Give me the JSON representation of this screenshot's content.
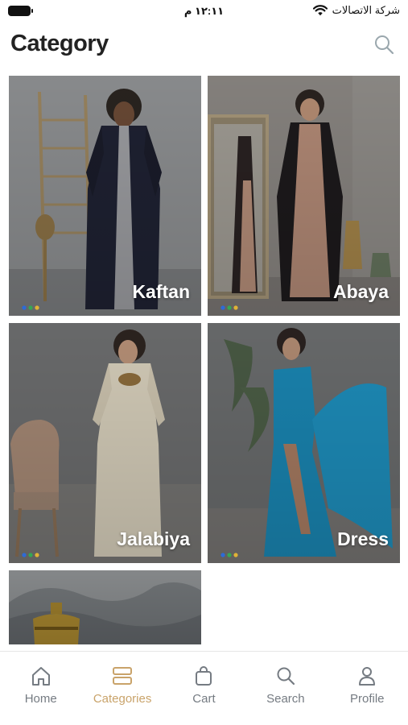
{
  "status_bar": {
    "time": "١٢:١١ م",
    "carrier": "شركة الاتصالات"
  },
  "header": {
    "title": "Category"
  },
  "categories": [
    {
      "label": "Kaftan"
    },
    {
      "label": "Abaya"
    },
    {
      "label": "Jalabiya"
    },
    {
      "label": "Dress"
    },
    {
      "label": ""
    }
  ],
  "tabbar": {
    "items": [
      {
        "label": "Home",
        "icon": "home-icon",
        "active": false
      },
      {
        "label": "Categories",
        "icon": "categories-icon",
        "active": true
      },
      {
        "label": "Cart",
        "icon": "cart-icon",
        "active": false
      },
      {
        "label": "Search",
        "icon": "search-icon",
        "active": false
      },
      {
        "label": "Profile",
        "icon": "profile-icon",
        "active": false
      }
    ]
  },
  "colors": {
    "accent": "#c9a36a",
    "tab_inactive": "#757b82",
    "title": "#222222"
  }
}
